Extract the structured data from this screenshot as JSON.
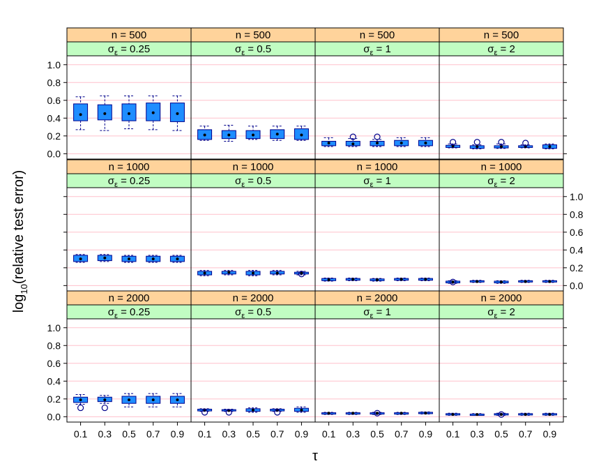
{
  "chart_data": {
    "type": "box",
    "ylabel_main": "log",
    "ylabel_sub": "10",
    "ylabel_rest": "(relative test error)",
    "xlabel": "τ",
    "x_tick_labels": [
      "0.1",
      "0.3",
      "0.5",
      "0.7",
      "0.9"
    ],
    "y_ticks": [
      0.0,
      0.2,
      0.4,
      0.6,
      0.8,
      1.0
    ],
    "y_tick_labels": [
      "0.0",
      "0.2",
      "0.4",
      "0.6",
      "0.8",
      "1.0"
    ],
    "ylim": [
      -0.06,
      1.1
    ],
    "grid": true,
    "colors": {
      "strip_n": "#ffd39b",
      "strip_sigma": "#c1fdc2",
      "box_fill": "#1f8dff",
      "box_border": "#00008b",
      "grid": "#ffc0cb",
      "point": "#000000"
    },
    "rows": [
      {
        "n_label": "n = 500",
        "panels": [
          {
            "sigma_label": "0.25",
            "boxes": [
              {
                "q1": 0.37,
                "q3": 0.56,
                "med": 0.44,
                "lo": 0.27,
                "hi": 0.64,
                "out": []
              },
              {
                "q1": 0.38,
                "q3": 0.55,
                "med": 0.45,
                "lo": 0.26,
                "hi": 0.65,
                "out": []
              },
              {
                "q1": 0.37,
                "q3": 0.56,
                "med": 0.45,
                "lo": 0.28,
                "hi": 0.65,
                "out": []
              },
              {
                "q1": 0.37,
                "q3": 0.57,
                "med": 0.46,
                "lo": 0.27,
                "hi": 0.65,
                "out": []
              },
              {
                "q1": 0.36,
                "q3": 0.57,
                "med": 0.45,
                "lo": 0.26,
                "hi": 0.65,
                "out": []
              }
            ]
          },
          {
            "sigma_label": "0.5",
            "boxes": [
              {
                "q1": 0.16,
                "q3": 0.27,
                "med": 0.21,
                "lo": 0.15,
                "hi": 0.31,
                "out": []
              },
              {
                "q1": 0.17,
                "q3": 0.26,
                "med": 0.21,
                "lo": 0.14,
                "hi": 0.32,
                "out": []
              },
              {
                "q1": 0.17,
                "q3": 0.26,
                "med": 0.21,
                "lo": 0.16,
                "hi": 0.31,
                "out": []
              },
              {
                "q1": 0.17,
                "q3": 0.27,
                "med": 0.22,
                "lo": 0.15,
                "hi": 0.31,
                "out": []
              },
              {
                "q1": 0.16,
                "q3": 0.28,
                "med": 0.21,
                "lo": 0.15,
                "hi": 0.31,
                "out": []
              }
            ]
          },
          {
            "sigma_label": "1",
            "boxes": [
              {
                "q1": 0.09,
                "q3": 0.14,
                "med": 0.12,
                "lo": 0.08,
                "hi": 0.18,
                "out": []
              },
              {
                "q1": 0.09,
                "q3": 0.14,
                "med": 0.11,
                "lo": 0.08,
                "hi": 0.17,
                "out": [
                  0.19
                ]
              },
              {
                "q1": 0.09,
                "q3": 0.14,
                "med": 0.12,
                "lo": 0.08,
                "hi": 0.16,
                "out": [
                  0.19
                ]
              },
              {
                "q1": 0.09,
                "q3": 0.15,
                "med": 0.12,
                "lo": 0.08,
                "hi": 0.18,
                "out": []
              },
              {
                "q1": 0.09,
                "q3": 0.15,
                "med": 0.12,
                "lo": 0.08,
                "hi": 0.18,
                "out": []
              }
            ]
          },
          {
            "sigma_label": "2",
            "boxes": [
              {
                "q1": 0.07,
                "q3": 0.095,
                "med": 0.085,
                "lo": 0.065,
                "hi": 0.11,
                "out": [
                  0.13
                ]
              },
              {
                "q1": 0.06,
                "q3": 0.09,
                "med": 0.08,
                "lo": 0.055,
                "hi": 0.1,
                "out": [
                  0.13
                ]
              },
              {
                "q1": 0.065,
                "q3": 0.09,
                "med": 0.08,
                "lo": 0.06,
                "hi": 0.11,
                "out": [
                  0.13
                ]
              },
              {
                "q1": 0.07,
                "q3": 0.09,
                "med": 0.08,
                "lo": 0.065,
                "hi": 0.1,
                "out": [
                  0.12
                ]
              },
              {
                "q1": 0.06,
                "q3": 0.1,
                "med": 0.08,
                "lo": 0.055,
                "hi": 0.11,
                "out": []
              }
            ]
          }
        ]
      },
      {
        "n_label": "n = 1000",
        "panels": [
          {
            "sigma_label": "0.25",
            "boxes": [
              {
                "q1": 0.27,
                "q3": 0.34,
                "med": 0.3,
                "lo": 0.26,
                "hi": 0.35,
                "out": []
              },
              {
                "q1": 0.28,
                "q3": 0.34,
                "med": 0.31,
                "lo": 0.27,
                "hi": 0.35,
                "out": []
              },
              {
                "q1": 0.27,
                "q3": 0.33,
                "med": 0.3,
                "lo": 0.26,
                "hi": 0.34,
                "out": []
              },
              {
                "q1": 0.27,
                "q3": 0.33,
                "med": 0.3,
                "lo": 0.26,
                "hi": 0.34,
                "out": []
              },
              {
                "q1": 0.27,
                "q3": 0.33,
                "med": 0.3,
                "lo": 0.26,
                "hi": 0.34,
                "out": []
              }
            ]
          },
          {
            "sigma_label": "0.5",
            "boxes": [
              {
                "q1": 0.12,
                "q3": 0.16,
                "med": 0.14,
                "lo": 0.11,
                "hi": 0.17,
                "out": []
              },
              {
                "q1": 0.13,
                "q3": 0.16,
                "med": 0.15,
                "lo": 0.12,
                "hi": 0.17,
                "out": []
              },
              {
                "q1": 0.12,
                "q3": 0.16,
                "med": 0.14,
                "lo": 0.11,
                "hi": 0.17,
                "out": []
              },
              {
                "q1": 0.13,
                "q3": 0.16,
                "med": 0.14,
                "lo": 0.12,
                "hi": 0.17,
                "out": []
              },
              {
                "q1": 0.13,
                "q3": 0.15,
                "med": 0.14,
                "lo": 0.12,
                "hi": 0.16,
                "out": [
                  0.13
                ]
              }
            ]
          },
          {
            "sigma_label": "1",
            "boxes": [
              {
                "q1": 0.055,
                "q3": 0.08,
                "med": 0.065,
                "lo": 0.05,
                "hi": 0.085,
                "out": []
              },
              {
                "q1": 0.06,
                "q3": 0.08,
                "med": 0.07,
                "lo": 0.055,
                "hi": 0.085,
                "out": []
              },
              {
                "q1": 0.055,
                "q3": 0.075,
                "med": 0.065,
                "lo": 0.05,
                "hi": 0.08,
                "out": []
              },
              {
                "q1": 0.06,
                "q3": 0.08,
                "med": 0.07,
                "lo": 0.055,
                "hi": 0.085,
                "out": []
              },
              {
                "q1": 0.06,
                "q3": 0.08,
                "med": 0.07,
                "lo": 0.055,
                "hi": 0.085,
                "out": []
              }
            ]
          },
          {
            "sigma_label": "2",
            "boxes": [
              {
                "q1": 0.03,
                "q3": 0.05,
                "med": 0.04,
                "lo": 0.025,
                "hi": 0.055,
                "out": [
                  0.04
                ]
              },
              {
                "q1": 0.04,
                "q3": 0.055,
                "med": 0.045,
                "lo": 0.035,
                "hi": 0.06,
                "out": []
              },
              {
                "q1": 0.03,
                "q3": 0.05,
                "med": 0.04,
                "lo": 0.025,
                "hi": 0.055,
                "out": []
              },
              {
                "q1": 0.04,
                "q3": 0.055,
                "med": 0.045,
                "lo": 0.035,
                "hi": 0.06,
                "out": []
              },
              {
                "q1": 0.04,
                "q3": 0.055,
                "med": 0.045,
                "lo": 0.035,
                "hi": 0.06,
                "out": []
              }
            ]
          }
        ]
      },
      {
        "n_label": "n = 2000",
        "panels": [
          {
            "sigma_label": "0.25",
            "boxes": [
              {
                "q1": 0.16,
                "q3": 0.22,
                "med": 0.19,
                "lo": 0.14,
                "hi": 0.25,
                "out": [
                  0.1
                ]
              },
              {
                "q1": 0.17,
                "q3": 0.22,
                "med": 0.19,
                "lo": 0.15,
                "hi": 0.24,
                "out": [
                  0.1
                ]
              },
              {
                "q1": 0.15,
                "q3": 0.23,
                "med": 0.19,
                "lo": 0.11,
                "hi": 0.26,
                "out": []
              },
              {
                "q1": 0.15,
                "q3": 0.23,
                "med": 0.19,
                "lo": 0.11,
                "hi": 0.26,
                "out": []
              },
              {
                "q1": 0.15,
                "q3": 0.23,
                "med": 0.19,
                "lo": 0.11,
                "hi": 0.26,
                "out": []
              }
            ]
          },
          {
            "sigma_label": "0.5",
            "boxes": [
              {
                "q1": 0.065,
                "q3": 0.085,
                "med": 0.075,
                "lo": 0.06,
                "hi": 0.09,
                "out": [
                  0.05
                ]
              },
              {
                "q1": 0.065,
                "q3": 0.08,
                "med": 0.07,
                "lo": 0.06,
                "hi": 0.085,
                "out": [
                  0.05
                ]
              },
              {
                "q1": 0.06,
                "q3": 0.09,
                "med": 0.075,
                "lo": 0.05,
                "hi": 0.1,
                "out": []
              },
              {
                "q1": 0.065,
                "q3": 0.085,
                "med": 0.075,
                "lo": 0.06,
                "hi": 0.09,
                "out": [
                  0.05
                ]
              },
              {
                "q1": 0.06,
                "q3": 0.095,
                "med": 0.075,
                "lo": 0.05,
                "hi": 0.11,
                "out": []
              }
            ]
          },
          {
            "sigma_label": "1",
            "boxes": [
              {
                "q1": 0.03,
                "q3": 0.045,
                "med": 0.04,
                "lo": 0.025,
                "hi": 0.05,
                "out": []
              },
              {
                "q1": 0.03,
                "q3": 0.045,
                "med": 0.04,
                "lo": 0.025,
                "hi": 0.05,
                "out": []
              },
              {
                "q1": 0.03,
                "q3": 0.045,
                "med": 0.04,
                "lo": 0.025,
                "hi": 0.05,
                "out": [
                  0.04
                ]
              },
              {
                "q1": 0.03,
                "q3": 0.045,
                "med": 0.04,
                "lo": 0.025,
                "hi": 0.05,
                "out": []
              },
              {
                "q1": 0.035,
                "q3": 0.05,
                "med": 0.04,
                "lo": 0.03,
                "hi": 0.055,
                "out": []
              }
            ]
          },
          {
            "sigma_label": "2",
            "boxes": [
              {
                "q1": 0.02,
                "q3": 0.035,
                "med": 0.025,
                "lo": 0.015,
                "hi": 0.04,
                "out": []
              },
              {
                "q1": 0.02,
                "q3": 0.03,
                "med": 0.025,
                "lo": 0.015,
                "hi": 0.035,
                "out": []
              },
              {
                "q1": 0.02,
                "q3": 0.035,
                "med": 0.025,
                "lo": 0.015,
                "hi": 0.04,
                "out": [
                  0.025
                ]
              },
              {
                "q1": 0.02,
                "q3": 0.035,
                "med": 0.025,
                "lo": 0.015,
                "hi": 0.04,
                "out": []
              },
              {
                "q1": 0.02,
                "q3": 0.035,
                "med": 0.025,
                "lo": 0.015,
                "hi": 0.04,
                "out": []
              }
            ]
          }
        ]
      }
    ]
  }
}
